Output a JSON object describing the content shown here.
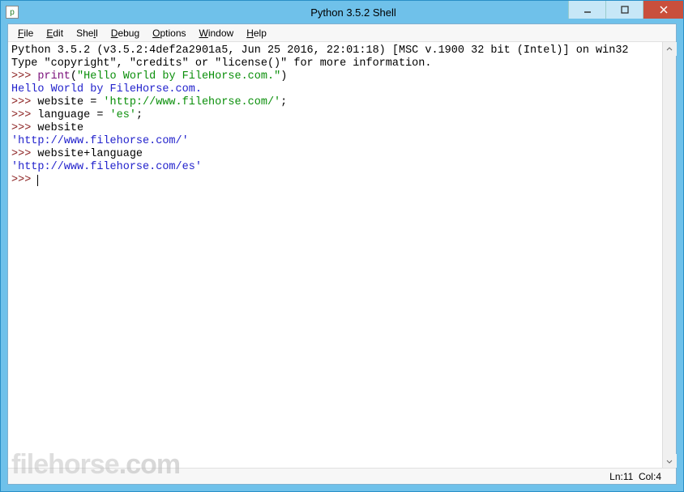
{
  "window": {
    "title": "Python 3.5.2 Shell",
    "icon_letter": "p"
  },
  "menu": {
    "file": "File",
    "edit": "Edit",
    "shell": "Shell",
    "debug": "Debug",
    "options": "Options",
    "window": "Window",
    "help": "Help"
  },
  "shell": {
    "banner1": "Python 3.5.2 (v3.5.2:4def2a2901a5, Jun 25 2016, 22:01:18) [MSC v.1900 32 bit (Intel)] on win32",
    "banner2": "Type \"copyright\", \"credits\" or \"license()\" for more information.",
    "prompt": ">>> ",
    "l1_builtin": "print",
    "l1_paren_open": "(",
    "l1_string": "\"Hello World by FileHorse.com.\"",
    "l1_paren_close": ")",
    "out1": "Hello World by FileHorse.com.",
    "l2a": "website = ",
    "l2s": "'http://www.filehorse.com/'",
    "l2b": ";",
    "l3a": "language = ",
    "l3s": "'es'",
    "l3b": ";",
    "l4": "website",
    "out4": "'http://www.filehorse.com/'",
    "l5": "website+language",
    "out5": "'http://www.filehorse.com/es'"
  },
  "status": {
    "ln_label": "Ln: ",
    "ln": "11",
    "col_label": "Col: ",
    "col": "4"
  },
  "watermark": {
    "text": "filehorse",
    "suffix": ".com"
  }
}
